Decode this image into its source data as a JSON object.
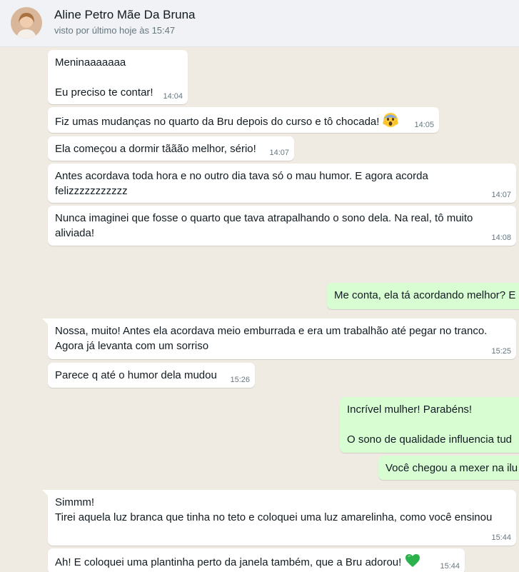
{
  "header": {
    "contact_name": "Aline Petro Mãe Da Bruna",
    "status": "visto por último hoje às 15:47"
  },
  "messages": [
    {
      "dir": "in",
      "text": "Meninaaaaaaa\n\nEu preciso te contar!",
      "time": "14:04"
    },
    {
      "dir": "in",
      "text": "Fiz umas mudanças no quarto da Bru depois do curso e tô chocada! ",
      "emoji": "scream-emoji",
      "time": "14:05"
    },
    {
      "dir": "in",
      "text": "Ela começou a dormir tããão melhor, sério!",
      "time": "14:07"
    },
    {
      "dir": "in",
      "text": "Antes acordava toda hora e no outro dia tava só o mau humor. E agora acorda\nfelizzzzzzzzzzz",
      "time": "14:07"
    },
    {
      "dir": "in",
      "text": "Nunca imaginei que fosse o quarto que tava atrapalhando o sono dela. Na real, tô muito\naliviada!",
      "time": "14:08"
    },
    {
      "dir": "out",
      "text": "Me conta, ela tá acordando melhor? E"
    },
    {
      "dir": "in",
      "text": "Nossa, muito! Antes ela acordava meio emburrada e era um trabalhão até pegar no tranco.\nAgora já levanta com um sorriso",
      "time": "15:25"
    },
    {
      "dir": "in",
      "text": "Parece q até o humor dela mudou",
      "time": "15:26"
    },
    {
      "dir": "out",
      "text": "Incrível mulher! Parabéns!\n\nO sono de qualidade influencia tud"
    },
    {
      "dir": "out",
      "text": "Você chegou a mexer na ilu"
    },
    {
      "dir": "in",
      "text": "Simmm!\nTirei aquela luz branca que tinha no teto e coloquei uma luz amarelinha, como você ensinou",
      "time": "15:44"
    },
    {
      "dir": "in",
      "text": "Ah! E coloquei uma plantinha perto da janela também, que a Bru adorou! ",
      "emoji": "green-heart-emoji",
      "time": "15:44"
    }
  ],
  "colors": {
    "incoming": "#ffffff",
    "outgoing": "#d9fdd3",
    "chat_bg": "#efeae2"
  }
}
